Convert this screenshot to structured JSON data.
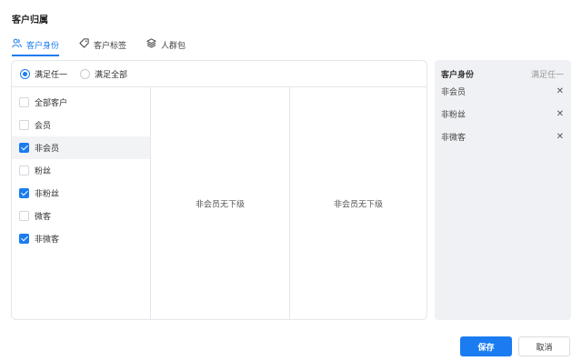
{
  "dialog": {
    "title": "客户归属"
  },
  "tabs": [
    {
      "label": "客户身份",
      "icon": "user-group-icon",
      "active": true
    },
    {
      "label": "客户标签",
      "icon": "tag-icon",
      "active": false
    },
    {
      "label": "人群包",
      "icon": "layers-icon",
      "active": false
    }
  ],
  "match_mode": {
    "options": [
      {
        "label": "满足任一",
        "checked": true
      },
      {
        "label": "满足全部",
        "checked": false
      }
    ]
  },
  "options": [
    {
      "label": "全部客户",
      "checked": false
    },
    {
      "label": "会员",
      "checked": false
    },
    {
      "label": "非会员",
      "checked": true
    },
    {
      "label": "粉丝",
      "checked": false
    },
    {
      "label": "非粉丝",
      "checked": true
    },
    {
      "label": "微客",
      "checked": false
    },
    {
      "label": "非微客",
      "checked": true
    }
  ],
  "sub_columns": {
    "col2_empty": "非会员无下级",
    "col3_empty": "非会员无下级"
  },
  "selected_panel": {
    "title": "客户身份",
    "mode": "满足任一",
    "items": [
      "非会员",
      "非粉丝",
      "非微客"
    ],
    "remove_glyph": "✕"
  },
  "buttons": {
    "save": "保存",
    "cancel": "取消"
  },
  "colors": {
    "accent": "#1a7cf0",
    "panel_bg": "#f0f1f4",
    "border": "#e3e6eb"
  }
}
